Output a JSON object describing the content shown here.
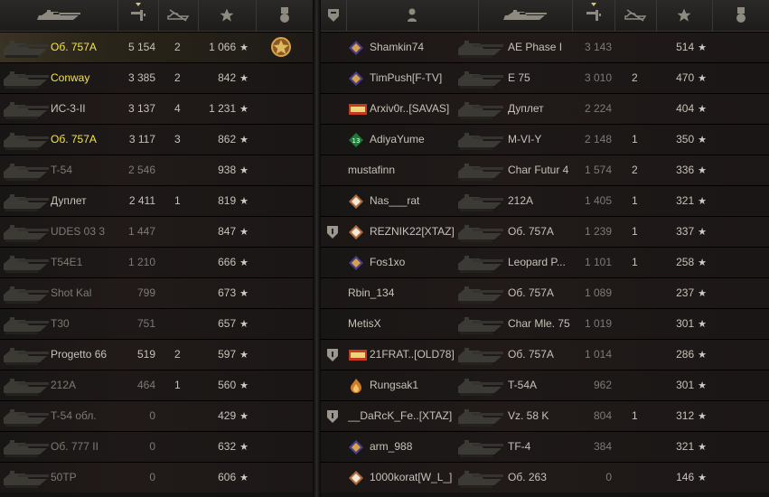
{
  "left_team": {
    "headers": [
      "tank-icon",
      "frags-icon",
      "kills-icon",
      "xp-star-icon",
      "medal-icon"
    ],
    "rows": [
      {
        "tank": "Об. 757А",
        "damage": "5 154",
        "kills": "2",
        "xp": "1 066",
        "style": "gold",
        "highlight": true,
        "medal": true
      },
      {
        "tank": "Conway",
        "damage": "3 385",
        "kills": "2",
        "xp": "842",
        "style": "gold",
        "highlight": false,
        "medal": false
      },
      {
        "tank": "ИС-3-II",
        "damage": "3 137",
        "kills": "4",
        "xp": "1 231",
        "style": "normal",
        "highlight": false,
        "medal": false
      },
      {
        "tank": "Об. 757А",
        "damage": "3 117",
        "kills": "3",
        "xp": "862",
        "style": "gold",
        "highlight": false,
        "medal": false
      },
      {
        "tank": "T-54",
        "damage": "2 546",
        "kills": "",
        "xp": "938",
        "style": "dim",
        "highlight": false,
        "medal": false
      },
      {
        "tank": "Дуплет",
        "damage": "2 411",
        "kills": "1",
        "xp": "819",
        "style": "normal",
        "highlight": false,
        "medal": false
      },
      {
        "tank": "UDES 03 3",
        "damage": "1 447",
        "kills": "",
        "xp": "847",
        "style": "dim",
        "highlight": false,
        "medal": false
      },
      {
        "tank": "T54E1",
        "damage": "1 210",
        "kills": "",
        "xp": "666",
        "style": "dim",
        "highlight": false,
        "medal": false
      },
      {
        "tank": "Shot Kal",
        "damage": "799",
        "kills": "",
        "xp": "673",
        "style": "dim",
        "highlight": false,
        "medal": false
      },
      {
        "tank": "T30",
        "damage": "751",
        "kills": "",
        "xp": "657",
        "style": "dim",
        "highlight": false,
        "medal": false
      },
      {
        "tank": "Progetto 66",
        "damage": "519",
        "kills": "2",
        "xp": "597",
        "style": "normal",
        "highlight": false,
        "medal": false
      },
      {
        "tank": "212A",
        "damage": "464",
        "kills": "1",
        "xp": "560",
        "style": "dim",
        "highlight": false,
        "medal": false
      },
      {
        "tank": "T-54 обл.",
        "damage": "0",
        "kills": "",
        "xp": "429",
        "style": "dim",
        "highlight": false,
        "medal": false
      },
      {
        "tank": "Об. 777 II",
        "damage": "0",
        "kills": "",
        "xp": "632",
        "style": "dim",
        "highlight": false,
        "medal": false
      },
      {
        "tank": "50TP",
        "damage": "0",
        "kills": "",
        "xp": "606",
        "style": "dim",
        "highlight": false,
        "medal": false
      }
    ]
  },
  "right_team": {
    "headers": [
      "platoon-icon",
      "player-icon",
      "tank-icon",
      "frags-icon",
      "kills-icon",
      "xp-star-icon",
      "medal-icon"
    ],
    "rows": [
      {
        "player": "Shamkin74",
        "badge": "rank",
        "tank": "AE Phase I",
        "damage": "3 143",
        "kills": "",
        "xp": "514",
        "platoon": false
      },
      {
        "player": "TimPush[F-TV]",
        "badge": "rank",
        "tank": "E 75",
        "damage": "3 010",
        "kills": "2",
        "xp": "470",
        "platoon": false
      },
      {
        "player": "Arxiv0r..[SAVAS]",
        "badge": "ebwa",
        "tank": "Дуплет",
        "damage": "2 224",
        "kills": "",
        "xp": "404",
        "platoon": false
      },
      {
        "player": "AdiyaYume",
        "badge": "13",
        "tank": "M-VI-Y",
        "damage": "2 148",
        "kills": "1",
        "xp": "350",
        "platoon": false
      },
      {
        "player": "mustafinn",
        "badge": "",
        "tank": "Char Futur 4",
        "damage": "1 574",
        "kills": "2",
        "xp": "336",
        "platoon": false
      },
      {
        "player": "Nas___rat",
        "badge": "2",
        "tank": "212A",
        "damage": "1 405",
        "kills": "1",
        "xp": "321",
        "platoon": false
      },
      {
        "player": "REZNIK22[XTAZ]",
        "badge": "1",
        "tank": "Об. 757А",
        "damage": "1 239",
        "kills": "1",
        "xp": "337",
        "platoon": true
      },
      {
        "player": "Fos1xo",
        "badge": "rank",
        "tank": "Leopard P...",
        "damage": "1 101",
        "kills": "1",
        "xp": "258",
        "platoon": false
      },
      {
        "player": "Rbin_134",
        "badge": "",
        "tank": "Об. 757А",
        "damage": "1 089",
        "kills": "",
        "xp": "237",
        "platoon": false
      },
      {
        "player": "MetisX",
        "badge": "",
        "tank": "Char Mle. 75",
        "damage": "1 019",
        "kills": "",
        "xp": "301",
        "platoon": false
      },
      {
        "player": "21FRAT..[OLD78]",
        "badge": "ebwa",
        "tank": "Об. 757А",
        "damage": "1 014",
        "kills": "",
        "xp": "286",
        "platoon": true
      },
      {
        "player": "Rungsak1",
        "badge": "flame",
        "tank": "T-54A",
        "damage": "962",
        "kills": "",
        "xp": "301",
        "platoon": false
      },
      {
        "player": "__DaRcK_Fe..[XTAZ]",
        "badge": "",
        "tank": "Vz. 58 K",
        "damage": "804",
        "kills": "1",
        "xp": "312",
        "platoon": true
      },
      {
        "player": "arm_988",
        "badge": "rank",
        "tank": "TF-4",
        "damage": "384",
        "kills": "",
        "xp": "321",
        "platoon": false
      },
      {
        "player": "1000korat[W_L_]",
        "badge": "1",
        "tank": "Об. 263",
        "damage": "0",
        "kills": "",
        "xp": "146",
        "platoon": false
      }
    ]
  },
  "colors": {
    "gold": "#f3e54b",
    "normal": "#d0ccc2",
    "dim": "#7d7a73",
    "highlight": "#3a3325"
  }
}
